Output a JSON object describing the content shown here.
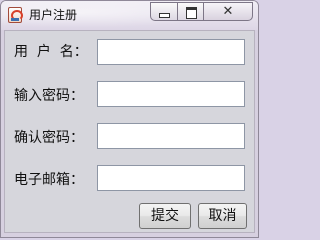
{
  "window": {
    "title": "用户注册",
    "close_glyph": "✕"
  },
  "form": {
    "fields": [
      {
        "label": "用  户  名：",
        "value": ""
      },
      {
        "label": "输入密码：",
        "value": ""
      },
      {
        "label": "确认密码：",
        "value": ""
      },
      {
        "label": "电子邮箱：",
        "value": ""
      }
    ],
    "submit_label": "提交",
    "cancel_label": "取消"
  },
  "icons": {
    "app": "java-cup-icon",
    "minimize": "minimize-icon",
    "maximize": "maximize-icon",
    "close": "close-icon"
  }
}
